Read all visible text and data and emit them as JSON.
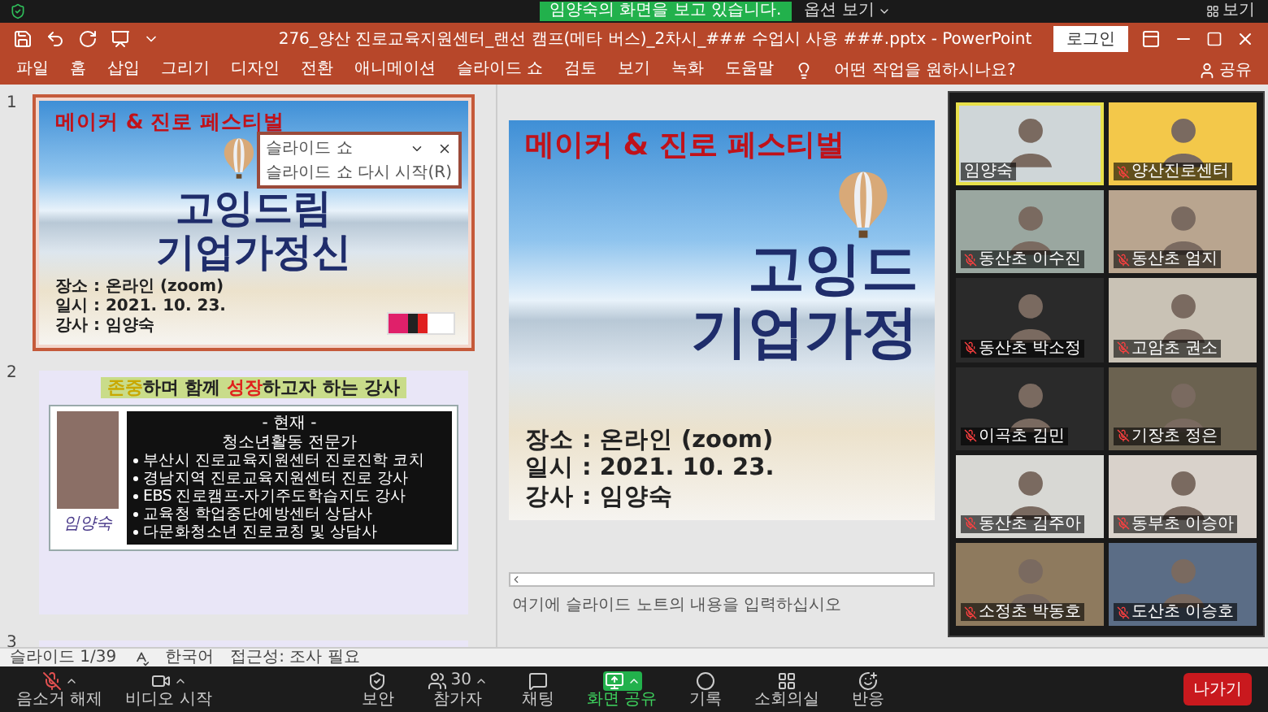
{
  "zoom_top": {
    "banner": "임양숙의 화면을 보고 있습니다.",
    "options": "옵션 보기",
    "view": "보기"
  },
  "window": {
    "title": "276_양산 진로교육지원센터_랜선 캠프(메타 버스)_2차시_### 수업시 사용 ###.pptx  -  PowerPoint",
    "login": "로그인"
  },
  "ribbon": {
    "tabs": [
      {
        "label": "파일",
        "selected": false
      },
      {
        "label": "홈",
        "selected": false
      },
      {
        "label": "삽입",
        "selected": false
      },
      {
        "label": "그리기",
        "selected": false
      },
      {
        "label": "디자인",
        "selected": false
      },
      {
        "label": "전환",
        "selected": false
      },
      {
        "label": "애니메이션",
        "selected": false
      },
      {
        "label": "슬라이드 쇼",
        "selected": false
      },
      {
        "label": "검토",
        "selected": false
      },
      {
        "label": "보기",
        "selected": false
      },
      {
        "label": "녹화",
        "selected": false
      },
      {
        "label": "도움말",
        "selected": false
      }
    ],
    "search": "어떤 작업을 원하시나요?",
    "share": "공유"
  },
  "thumbnails": [
    {
      "number": "1",
      "kind": "title",
      "selected": true,
      "festival": "메이커 & 진로 페스티벌",
      "title_lines": [
        "고잉드림",
        "기업가정신"
      ],
      "info": [
        "장소 : 온라인 (zoom)",
        "일시 : 2021. 10. 23.",
        "강사 : 임양숙"
      ]
    },
    {
      "number": "2",
      "kind": "profile",
      "selected": false,
      "heading": [
        {
          "text": "존중",
          "kind": "highlight"
        },
        {
          "text": "하며 함께 ",
          "kind": "plain"
        },
        {
          "text": "성장",
          "kind": "accent"
        },
        {
          "text": "하고자 하는 강사",
          "kind": "plain"
        }
      ],
      "name": "임양숙",
      "box_title": "- 현재 -",
      "role": "청소년활동 전문가",
      "bullets": [
        "부산시 진로교육지원센터 진로진학 코치",
        "경남지역 진로교육지원센터 진로 강사",
        "EBS 진로캠프-자기주도학습지도 강사",
        "교육청 학업중단예방센터 상담사",
        "다문화청소년 진로코칭 및 상담사"
      ]
    },
    {
      "number": "3",
      "kind": "banner",
      "selected": false
    }
  ],
  "popup": {
    "title": "슬라이드 쇼",
    "item": "슬라이드 쇼 다시 시작(R)"
  },
  "main_slide": {
    "festival": "메이커 & 진로 페스티벌",
    "title_lines": [
      "고잉드",
      "기업가정"
    ],
    "info": [
      "장소 : 온라인 (zoom)",
      "일시 : 2021. 10. 23.",
      "강사 : 임양숙"
    ]
  },
  "notes": {
    "placeholder": "여기에 슬라이드 노트의 내용을 입력하십시오"
  },
  "status_bar": {
    "slide": "슬라이드 1/39",
    "language": "한국어",
    "accessibility": "접근성: 조사 필요"
  },
  "gallery": {
    "tiles": [
      {
        "name": "임양숙",
        "speaking": true,
        "muted": false
      },
      {
        "name": "양산진로센터",
        "speaking": false,
        "muted": true
      },
      {
        "name": "동산초 이수진",
        "speaking": false,
        "muted": true
      },
      {
        "name": "동산초 엄지",
        "speaking": false,
        "muted": true
      },
      {
        "name": "동산초 박소정",
        "speaking": false,
        "muted": true
      },
      {
        "name": "고암초 권소",
        "speaking": false,
        "muted": true
      },
      {
        "name": "이곡초 김민",
        "speaking": false,
        "muted": true
      },
      {
        "name": "기장초 정은",
        "speaking": false,
        "muted": true
      },
      {
        "name": "동산초 김주아",
        "speaking": false,
        "muted": true
      },
      {
        "name": "동부초 이승아",
        "speaking": false,
        "muted": true
      },
      {
        "name": "소정초 박동호",
        "speaking": false,
        "muted": true
      },
      {
        "name": "도산초 이승호",
        "speaking": false,
        "muted": true
      }
    ]
  },
  "toolbar": {
    "items": [
      {
        "kind": "mic",
        "label": "음소거 해제",
        "menu": true,
        "active": false
      },
      {
        "kind": "video",
        "label": "비디오 시작",
        "menu": true,
        "active": false
      },
      {
        "kind": "security",
        "label": "보안",
        "menu": false,
        "active": false
      },
      {
        "kind": "participants",
        "label": "참가자",
        "count": "30",
        "menu": true,
        "active": false
      },
      {
        "kind": "chat",
        "label": "채팅",
        "menu": false,
        "active": false
      },
      {
        "kind": "share",
        "label": "화면 공유",
        "menu": true,
        "active": true
      },
      {
        "kind": "record",
        "label": "기록",
        "menu": false,
        "active": false
      },
      {
        "kind": "breakout",
        "label": "소회의실",
        "menu": false,
        "active": false
      },
      {
        "kind": "reactions",
        "label": "반응",
        "menu": false,
        "active": false
      }
    ],
    "leave": "나가기"
  }
}
